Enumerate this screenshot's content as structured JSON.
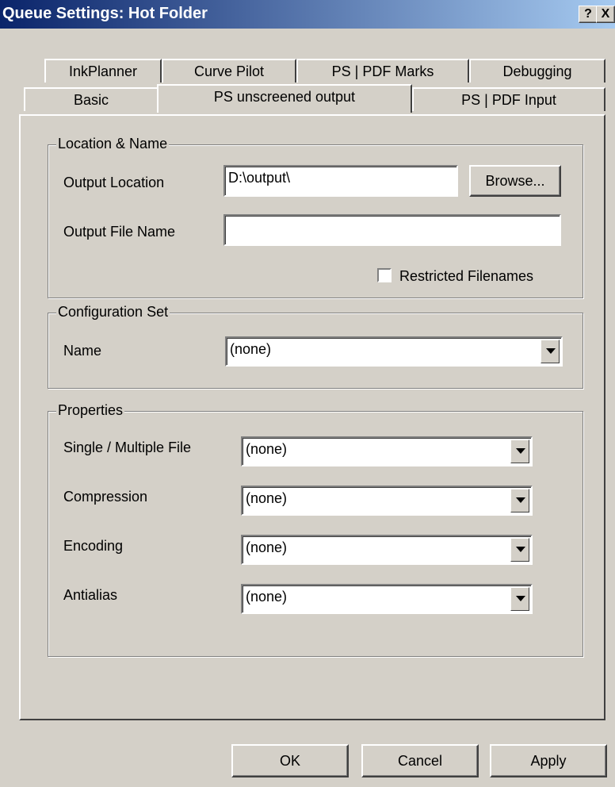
{
  "window": {
    "title": "Queue Settings: Hot Folder",
    "help_glyph": "?",
    "close_glyph": "X"
  },
  "tabs": {
    "row_top": [
      "InkPlanner",
      "Curve Pilot",
      "PS | PDF Marks",
      "Debugging"
    ],
    "row_bottom": [
      "Basic",
      "PS unscreened output",
      "PS | PDF Input"
    ],
    "active": "PS unscreened output"
  },
  "location_name": {
    "legend": "Location & Name",
    "output_location_label": "Output Location",
    "output_location_value": "D:\\output\\",
    "browse_label": "Browse...",
    "output_file_name_label": "Output File Name",
    "output_file_name_value": "",
    "restricted_label": "Restricted Filenames"
  },
  "configuration_set": {
    "legend": "Configuration Set",
    "name_label": "Name",
    "name_value": "(none)"
  },
  "properties": {
    "legend": "Properties",
    "rows": [
      {
        "label": "Single / Multiple  File",
        "value": "(none)"
      },
      {
        "label": "Compression",
        "value": "(none)"
      },
      {
        "label": "Encoding",
        "value": "(none)"
      },
      {
        "label": "Antialias",
        "value": "(none)"
      }
    ]
  },
  "footer": {
    "ok_label": "OK",
    "cancel_label": "Cancel",
    "apply_label": "Apply"
  }
}
